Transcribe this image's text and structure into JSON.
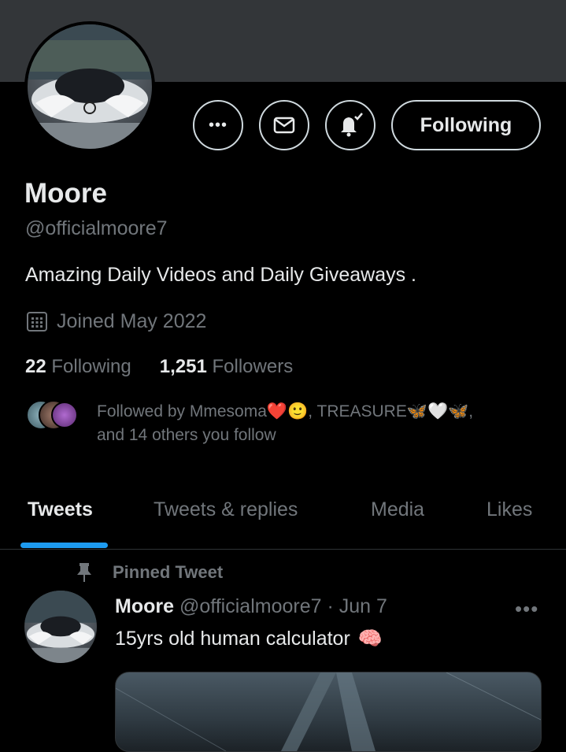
{
  "profile": {
    "name": "Moore",
    "handle": "@officialmoore7",
    "bio": "Amazing Daily Videos and Daily Giveaways .",
    "joined": "Joined May 2022",
    "following_count": "22",
    "following_label": "Following",
    "followers_count": "1,251",
    "followers_label": "Followers",
    "followed_by_line1": "Followed by Mmesoma❤️🙂, TREASURE🦋🤍🦋,",
    "followed_by_line2": "and 14 others you follow"
  },
  "actions": {
    "more_label": "•••",
    "message_icon": "mail-icon",
    "notify_icon": "bell-check-icon",
    "follow_label": "Following"
  },
  "tabs": [
    {
      "label": "Tweets",
      "active": true
    },
    {
      "label": "Tweets & replies",
      "active": false
    },
    {
      "label": "Media",
      "active": false
    },
    {
      "label": "Likes",
      "active": false
    }
  ],
  "tweet": {
    "pinned_label": "Pinned Tweet",
    "author_name": "Moore",
    "author_handle": "@officialmoore7",
    "separator": "·",
    "date": "Jun 7",
    "text": "15yrs old human calculator",
    "emoji": "🧠",
    "more_label": "•••"
  },
  "colors": {
    "accent": "#1d9bf0",
    "background": "#000000",
    "banner": "#333639",
    "muted": "#71767b",
    "text": "#e7e9ea"
  }
}
